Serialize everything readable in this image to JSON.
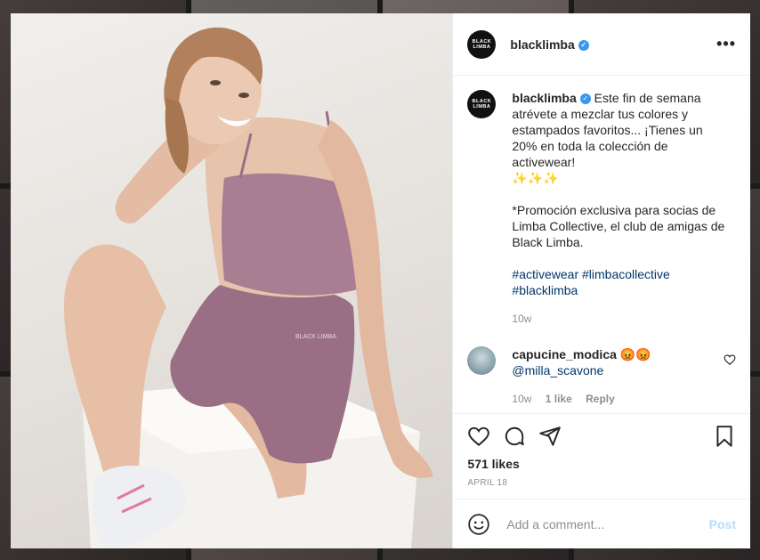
{
  "post": {
    "username": "blacklimba",
    "logo_text_top": "BLACK",
    "logo_text_bottom": "LIMBA",
    "verified_mark": "✓",
    "more_label": "•••"
  },
  "caption": {
    "username": "blacklimba",
    "text1": "Este fin de semana atrévete a mezclar tus colores y estampados favoritos... ¡Tienes un 20% en toda la colección de activewear!",
    "emojis": "✨✨✨",
    "text2": "*Promoción exclusiva para socias de Limba Collective, el club de amigas de Black Limba.",
    "tags": [
      "#activewear",
      "#limbacollective",
      "#blacklimba"
    ],
    "time": "10w"
  },
  "comment": {
    "username": "capucine_modica",
    "emojis": "😡😡",
    "mention": "@milla_scavone",
    "time": "10w",
    "likes": "1 like",
    "reply": "Reply"
  },
  "actions": {
    "likes": "571 likes",
    "date": "APRIL 18"
  },
  "add_comment": {
    "placeholder": "Add a comment...",
    "post_label": "Post"
  },
  "photo": {
    "shorts_logo": "BLACK LIMBA"
  },
  "colors": {
    "accent": "#3897f0",
    "post_disabled": "#b2dffc",
    "hashtag": "#00376b",
    "outfit": "#9a6f85"
  }
}
